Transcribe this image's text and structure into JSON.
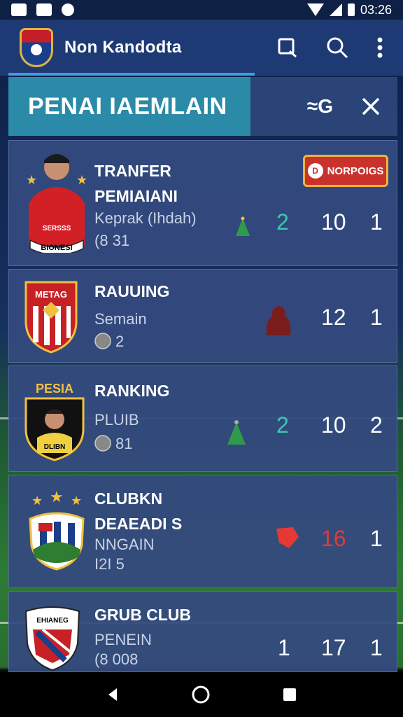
{
  "status_bar": {
    "time": "03:26"
  },
  "app_bar": {
    "title": "Non Kandodta",
    "actions": [
      "checklist-icon",
      "search-icon",
      "more-vert-icon"
    ]
  },
  "panel": {
    "title": "PENAI IAEMLAIN",
    "filter_label": "≈G",
    "close_icon": "close-icon"
  },
  "cards": [
    {
      "line1": "TRANFER",
      "line2": "PEMIAIANI",
      "line3": "Keprak (Ihdah)",
      "line4": "(8 31",
      "badge": "NORPOIGS",
      "stat_a": "2",
      "stat_b": "10",
      "stat_c": "1",
      "crest_text": "BIONESI",
      "crest_shirt": "SERSSS"
    },
    {
      "line1": "RAUUING",
      "line3": "Semain",
      "line4": "2",
      "stat_b": "12",
      "stat_c": "1",
      "crest_text": "METAG"
    },
    {
      "line1": "RANKING",
      "line3": "PLUIB",
      "line4": "81",
      "stat_a": "2",
      "stat_b": "10",
      "stat_c": "2",
      "crest_text": "PESIA",
      "crest_banner": "DLIBN"
    },
    {
      "line1": "CLUBKN",
      "line2": "DEAEADI S",
      "line3": "NNGAIN",
      "line4": "I2I 5",
      "stat_b": "16",
      "stat_c": "1"
    },
    {
      "line1": "GRUB CLUB",
      "line3": "PENEIN",
      "line4": "(8 008",
      "stat_a": "1",
      "stat_b": "17",
      "stat_c": "1",
      "crest_text": "EHIANEG"
    }
  ],
  "colors": {
    "accent": "#2a8aa8",
    "teal": "#3cc7b0",
    "red": "#e53935",
    "badge": "#c9322c"
  }
}
